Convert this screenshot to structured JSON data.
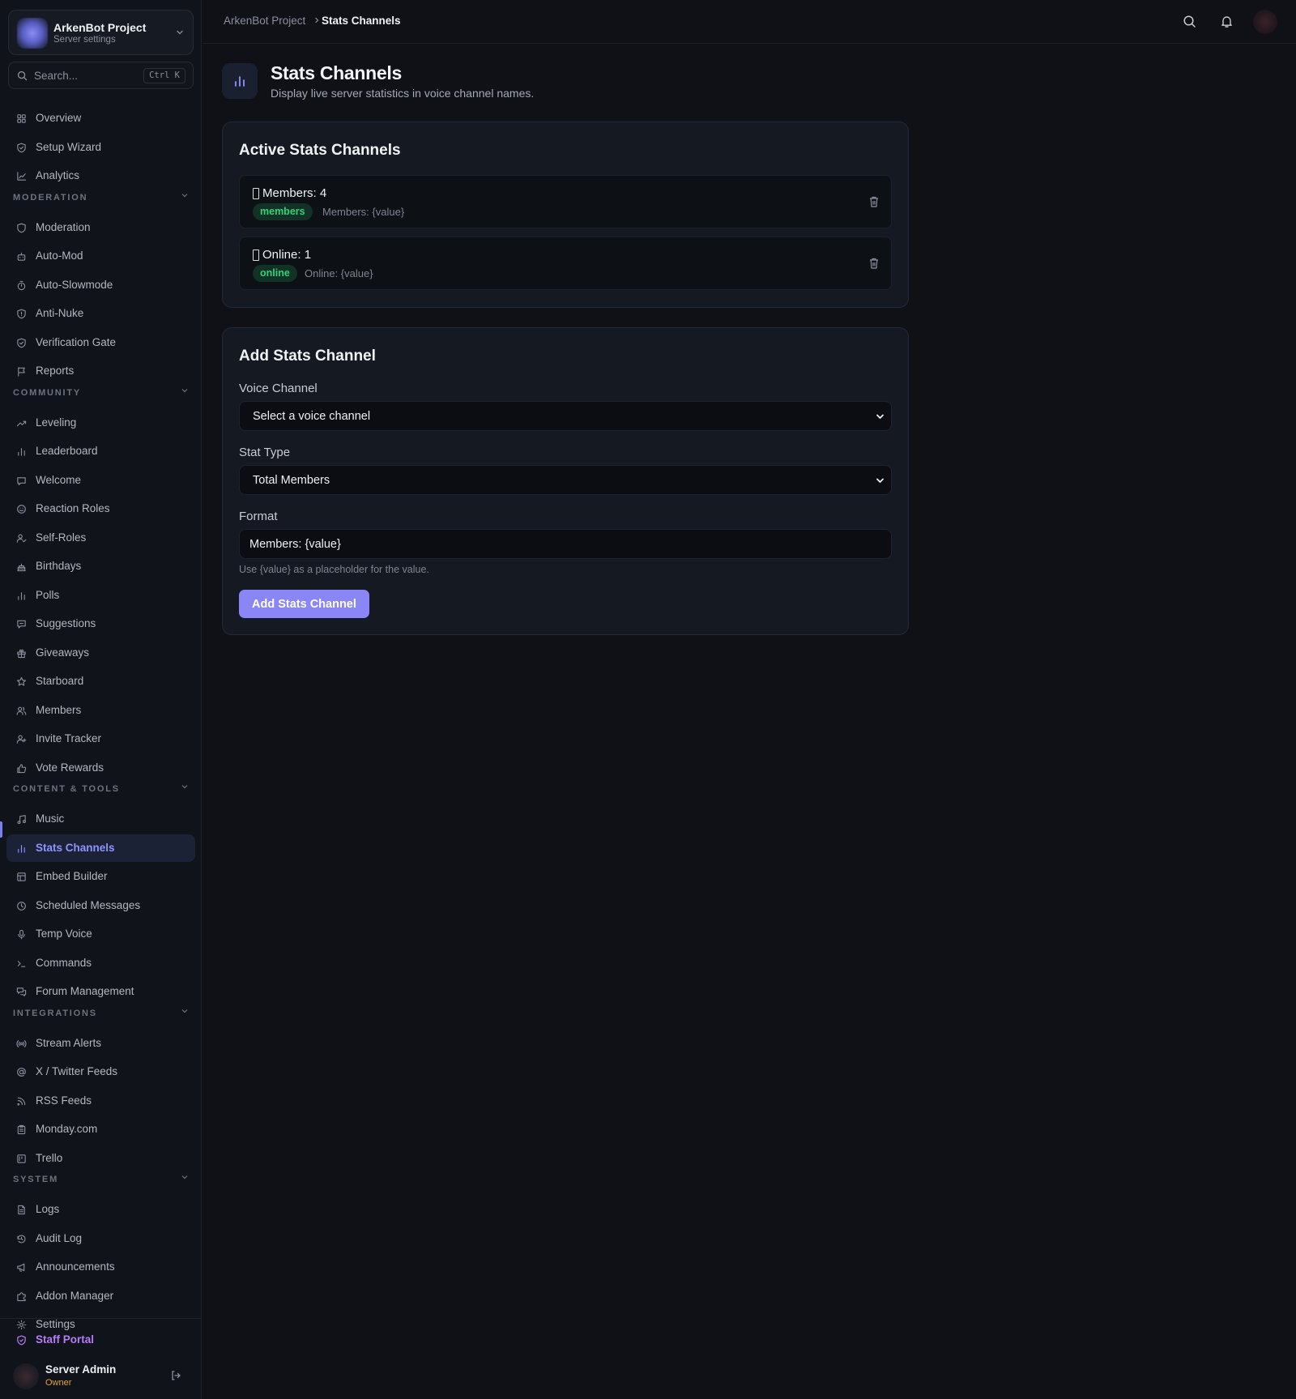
{
  "server": {
    "name": "ArkenBot Project",
    "subtitle": "Server settings"
  },
  "search": {
    "placeholder": "Search...",
    "shortcut": "Ctrl K"
  },
  "nav": {
    "top": [
      {
        "label": "Overview",
        "icon": "grid-icon"
      },
      {
        "label": "Setup Wizard",
        "icon": "shield-check-icon"
      },
      {
        "label": "Analytics",
        "icon": "line-chart-icon"
      }
    ],
    "sections": [
      {
        "title": "MODERATION",
        "items": [
          {
            "label": "Moderation",
            "icon": "shield-icon"
          },
          {
            "label": "Auto-Mod",
            "icon": "bot-icon"
          },
          {
            "label": "Auto-Slowmode",
            "icon": "timer-icon"
          },
          {
            "label": "Anti-Nuke",
            "icon": "shield-alert-icon"
          },
          {
            "label": "Verification Gate",
            "icon": "shield-check-icon"
          },
          {
            "label": "Reports",
            "icon": "flag-icon"
          }
        ]
      },
      {
        "title": "COMMUNITY",
        "items": [
          {
            "label": "Leveling",
            "icon": "trending-up-icon"
          },
          {
            "label": "Leaderboard",
            "icon": "bar-chart-icon"
          },
          {
            "label": "Welcome",
            "icon": "message-icon"
          },
          {
            "label": "Reaction Roles",
            "icon": "smile-icon"
          },
          {
            "label": "Self-Roles",
            "icon": "user-check-icon"
          },
          {
            "label": "Birthdays",
            "icon": "cake-icon"
          },
          {
            "label": "Polls",
            "icon": "bar-chart-icon"
          },
          {
            "label": "Suggestions",
            "icon": "message-square-icon"
          },
          {
            "label": "Giveaways",
            "icon": "gift-icon"
          },
          {
            "label": "Starboard",
            "icon": "star-icon"
          },
          {
            "label": "Members",
            "icon": "users-icon"
          },
          {
            "label": "Invite Tracker",
            "icon": "user-plus-icon"
          },
          {
            "label": "Vote Rewards",
            "icon": "thumbs-up-icon"
          }
        ]
      },
      {
        "title": "CONTENT & TOOLS",
        "items": [
          {
            "label": "Music",
            "icon": "music-icon"
          },
          {
            "label": "Stats Channels",
            "icon": "bar-chart-icon",
            "active": true
          },
          {
            "label": "Embed Builder",
            "icon": "layout-icon"
          },
          {
            "label": "Scheduled Messages",
            "icon": "clock-icon"
          },
          {
            "label": "Temp Voice",
            "icon": "mic-icon"
          },
          {
            "label": "Commands",
            "icon": "terminal-icon"
          },
          {
            "label": "Forum Management",
            "icon": "messages-icon"
          }
        ]
      },
      {
        "title": "INTEGRATIONS",
        "items": [
          {
            "label": "Stream Alerts",
            "icon": "radio-icon"
          },
          {
            "label": "X / Twitter Feeds",
            "icon": "at-sign-icon"
          },
          {
            "label": "RSS Feeds",
            "icon": "rss-icon"
          },
          {
            "label": "Monday.com",
            "icon": "clipboard-icon"
          },
          {
            "label": "Trello",
            "icon": "trello-icon"
          }
        ]
      },
      {
        "title": "SYSTEM",
        "items": [
          {
            "label": "Logs",
            "icon": "file-text-icon"
          },
          {
            "label": "Audit Log",
            "icon": "history-icon"
          },
          {
            "label": "Announcements",
            "icon": "megaphone-icon"
          },
          {
            "label": "Addon Manager",
            "icon": "puzzle-icon"
          },
          {
            "label": "Settings",
            "icon": "gear-icon"
          }
        ]
      }
    ]
  },
  "footer": {
    "staff_portal": "Staff Portal",
    "user_name": "Server Admin",
    "user_role": "Owner"
  },
  "breadcrumb": {
    "root": "ArkenBot Project",
    "current": "Stats Channels"
  },
  "page": {
    "title": "Stats Channels",
    "description": "Display live server statistics in voice channel names."
  },
  "active_card": {
    "title": "Active Stats Channels",
    "channels": [
      {
        "name": "Members: 4",
        "type": "members",
        "format": "Members: {value}"
      },
      {
        "name": "Online: 1",
        "type": "online",
        "format": "Online: {value}"
      }
    ]
  },
  "add_card": {
    "title": "Add Stats Channel",
    "voice_label": "Voice Channel",
    "voice_value": "Select a voice channel",
    "stat_label": "Stat Type",
    "stat_value": "Total Members",
    "format_label": "Format",
    "format_value": "Members: {value}",
    "help": "Use {value} as a placeholder for the value.",
    "submit": "Add Stats Channel"
  },
  "colors": {
    "accent": "#8b86f5",
    "badge_green": "#33d17a",
    "owner_gold": "#e0a63a",
    "staff_purple": "#b57cf7"
  }
}
